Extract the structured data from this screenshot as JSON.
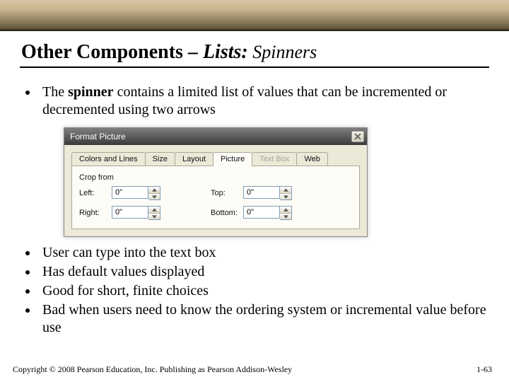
{
  "title": {
    "part1": "Other Components – ",
    "part2_italic": "Lists:",
    "part3_sub": " Spinners"
  },
  "bullet1_pre": "The ",
  "bullet1_bold": "spinner",
  "bullet1_post": " contains a limited list of values that can be incremented or decremented using two arrows",
  "dialog": {
    "title": "Format Picture",
    "tabs": {
      "t0": "Colors and Lines",
      "t1": "Size",
      "t2": "Layout",
      "t3": "Picture",
      "t4": "Text Box",
      "t5": "Web"
    },
    "section": "Crop from",
    "labels": {
      "left": "Left:",
      "top": "Top:",
      "right": "Right:",
      "bottom": "Bottom:"
    },
    "values": {
      "left": "0\"",
      "top": "0\"",
      "right": "0\"",
      "bottom": "0\""
    }
  },
  "bullets2": {
    "b0": "User can type into the text box",
    "b1": "Has default values displayed",
    "b2": "Good for short, finite choices",
    "b3": "Bad when users need to know the ordering system or incremental value before use"
  },
  "footer": {
    "copyright": "Copyright © 2008 Pearson Education, Inc. Publishing as Pearson Addison-Wesley",
    "page": "1-63"
  }
}
